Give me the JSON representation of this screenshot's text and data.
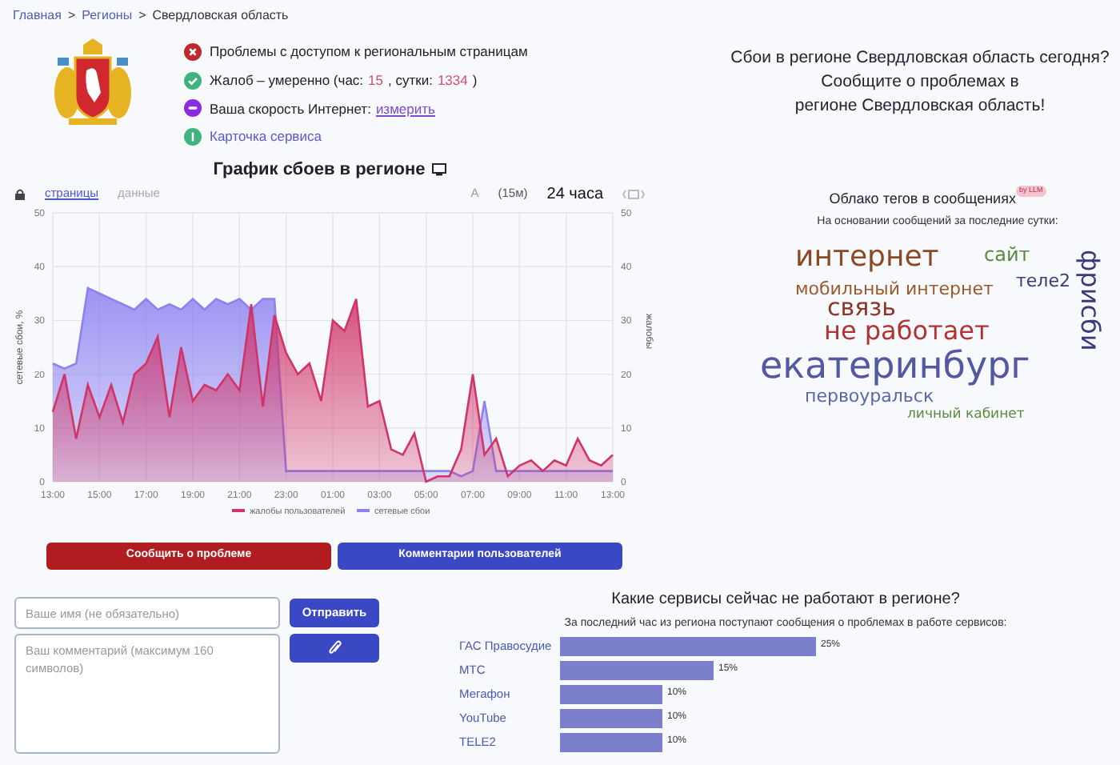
{
  "breadcrumb": [
    {
      "text": "Главная",
      "link": true
    },
    {
      "text": ">",
      "link": false
    },
    {
      "text": "Регионы",
      "link": true
    },
    {
      "text": ">",
      "link": false
    },
    {
      "text": "Свердловская область",
      "link": false
    }
  ],
  "status": [
    {
      "kind": "error",
      "segments": [
        {
          "kind": "plain",
          "text": "Проблемы с доступом к региональным страницам"
        }
      ]
    },
    {
      "kind": "ok",
      "segments": [
        {
          "kind": "plain",
          "text": "Жалоб – умеренно (час:"
        },
        {
          "kind": "number",
          "text": "15"
        },
        {
          "kind": "plain",
          "text": ", сутки:"
        },
        {
          "kind": "number",
          "text": "1334"
        },
        {
          "kind": "plain",
          "text": ")"
        }
      ]
    },
    {
      "kind": "speed",
      "segments": [
        {
          "kind": "plain",
          "text": "Ваша скорость Интернет:"
        },
        {
          "kind": "link",
          "text": "измерить"
        }
      ]
    },
    {
      "kind": "info",
      "segments": [
        {
          "kind": "link-plain",
          "text": "Карточка сервиса"
        }
      ]
    }
  ],
  "headline": [
    "Сбои в регионе Свердловская область сегодня?",
    "Сообщите о проблемах в",
    "регионе Свердловская область!"
  ],
  "outage_chart": {
    "title": "График сбоев в регионе",
    "tabs": [
      {
        "label": "страницы",
        "selected": true
      },
      {
        "label": "данные",
        "selected": false
      }
    ],
    "font_toggle": "A",
    "interval": "(15м)",
    "period": "24 часа",
    "chart_data": {
      "type": "area",
      "ylabel": "сетевые сбои, %",
      "y2label": "жалобы",
      "ylim": [
        0,
        50
      ],
      "yticks": [
        0,
        10,
        20,
        30,
        40,
        50
      ],
      "y2ticks": [
        0,
        10,
        20,
        30,
        40,
        50
      ],
      "grid": true,
      "legend": "bottom",
      "y2lim": [
        0,
        50
      ],
      "categories": [
        "13:00",
        null,
        null,
        null,
        "15:00",
        null,
        null,
        null,
        "17:00",
        null,
        null,
        null,
        "19:00",
        null,
        null,
        null,
        "21:00",
        null,
        null,
        null,
        "23:00",
        null,
        null,
        null,
        "01:00",
        null,
        null,
        null,
        "03:00",
        null,
        null,
        null,
        "05:00",
        null,
        null,
        null,
        "07:00",
        null,
        null,
        null,
        "09:00",
        null,
        null,
        null,
        "11:00",
        null,
        null,
        null,
        "13:00"
      ],
      "series": [
        {
          "name": "жалобы пользователей",
          "color": "#d03468",
          "values": [
            13,
            20,
            8,
            18,
            12,
            18,
            11,
            20,
            22,
            27,
            12,
            25,
            15,
            18,
            17,
            20,
            17,
            33,
            14,
            31,
            24,
            20,
            22,
            15,
            30,
            28,
            34,
            14,
            15,
            6,
            5,
            9,
            0,
            1,
            1,
            6,
            20,
            5,
            8,
            1,
            3,
            4,
            2,
            4,
            3,
            8,
            4,
            3,
            5
          ]
        },
        {
          "name": "сетевые сбои",
          "color": "#8c82f0",
          "values": [
            22,
            21,
            22,
            36,
            35,
            34,
            33,
            32,
            34,
            32,
            33,
            32,
            34,
            32,
            34,
            33,
            34,
            32,
            34,
            34,
            2,
            2,
            2,
            2,
            2,
            2,
            2,
            2,
            2,
            2,
            2,
            2,
            2,
            2,
            2,
            1,
            2,
            15,
            2,
            2,
            2,
            2,
            2,
            2,
            2,
            2,
            2,
            2,
            2
          ]
        }
      ]
    }
  },
  "tag_cloud": {
    "title": "Облако тегов в сообщениях",
    "badge": "by LLM",
    "subtitle": "На основании сообщений за последние сутки:",
    "tags": [
      {
        "text": "интернет",
        "color": "#8a4a24",
        "vertical": false
      },
      {
        "text": "сайт",
        "color": "#5a8a3c",
        "vertical": false
      },
      {
        "text": "теле2",
        "color": "#383c78",
        "vertical": false
      },
      {
        "text": "мобильный интернет",
        "color": "#9a5a2c",
        "vertical": false
      },
      {
        "text": "связь",
        "color": "#8c3428",
        "vertical": false
      },
      {
        "text": "не работает",
        "color": "#b03232",
        "vertical": false
      },
      {
        "text": "екатеринбург",
        "color": "#5258a2",
        "vertical": false
      },
      {
        "text": "первоуральск",
        "color": "#5a66a6",
        "vertical": false
      },
      {
        "text": "личный кабинет",
        "color": "#5a8a3c",
        "vertical": false
      },
      {
        "text": "фрисби",
        "color": "#383c78",
        "vertical": true
      }
    ]
  },
  "actions": [
    {
      "kind": "report",
      "label": "Сообщить о проблеме"
    },
    {
      "kind": "comments",
      "label": "Комментарии пользователей"
    }
  ],
  "comment_form": {
    "name_placeholder": "Ваше имя (не обязательно)",
    "comment_placeholder": "Ваш комментарий (максимум 160 символов)",
    "send": "Отправить"
  },
  "services": {
    "title": "Какие сервисы сейчас не работают в регионе?",
    "subtitle": "За последний час из региона поступают сообщения о проблемах в работе сервисов:",
    "chart_data": {
      "type": "bar",
      "orientation": "horizontal",
      "categories": [
        "ГАС Правосудие",
        "МТС",
        "Мегафон",
        "YouTube",
        "TELE2"
      ],
      "values": [
        25,
        15,
        10,
        10,
        10
      ],
      "value_labels": [
        "25%",
        "15%",
        "10%",
        "10%",
        "10%"
      ]
    }
  }
}
